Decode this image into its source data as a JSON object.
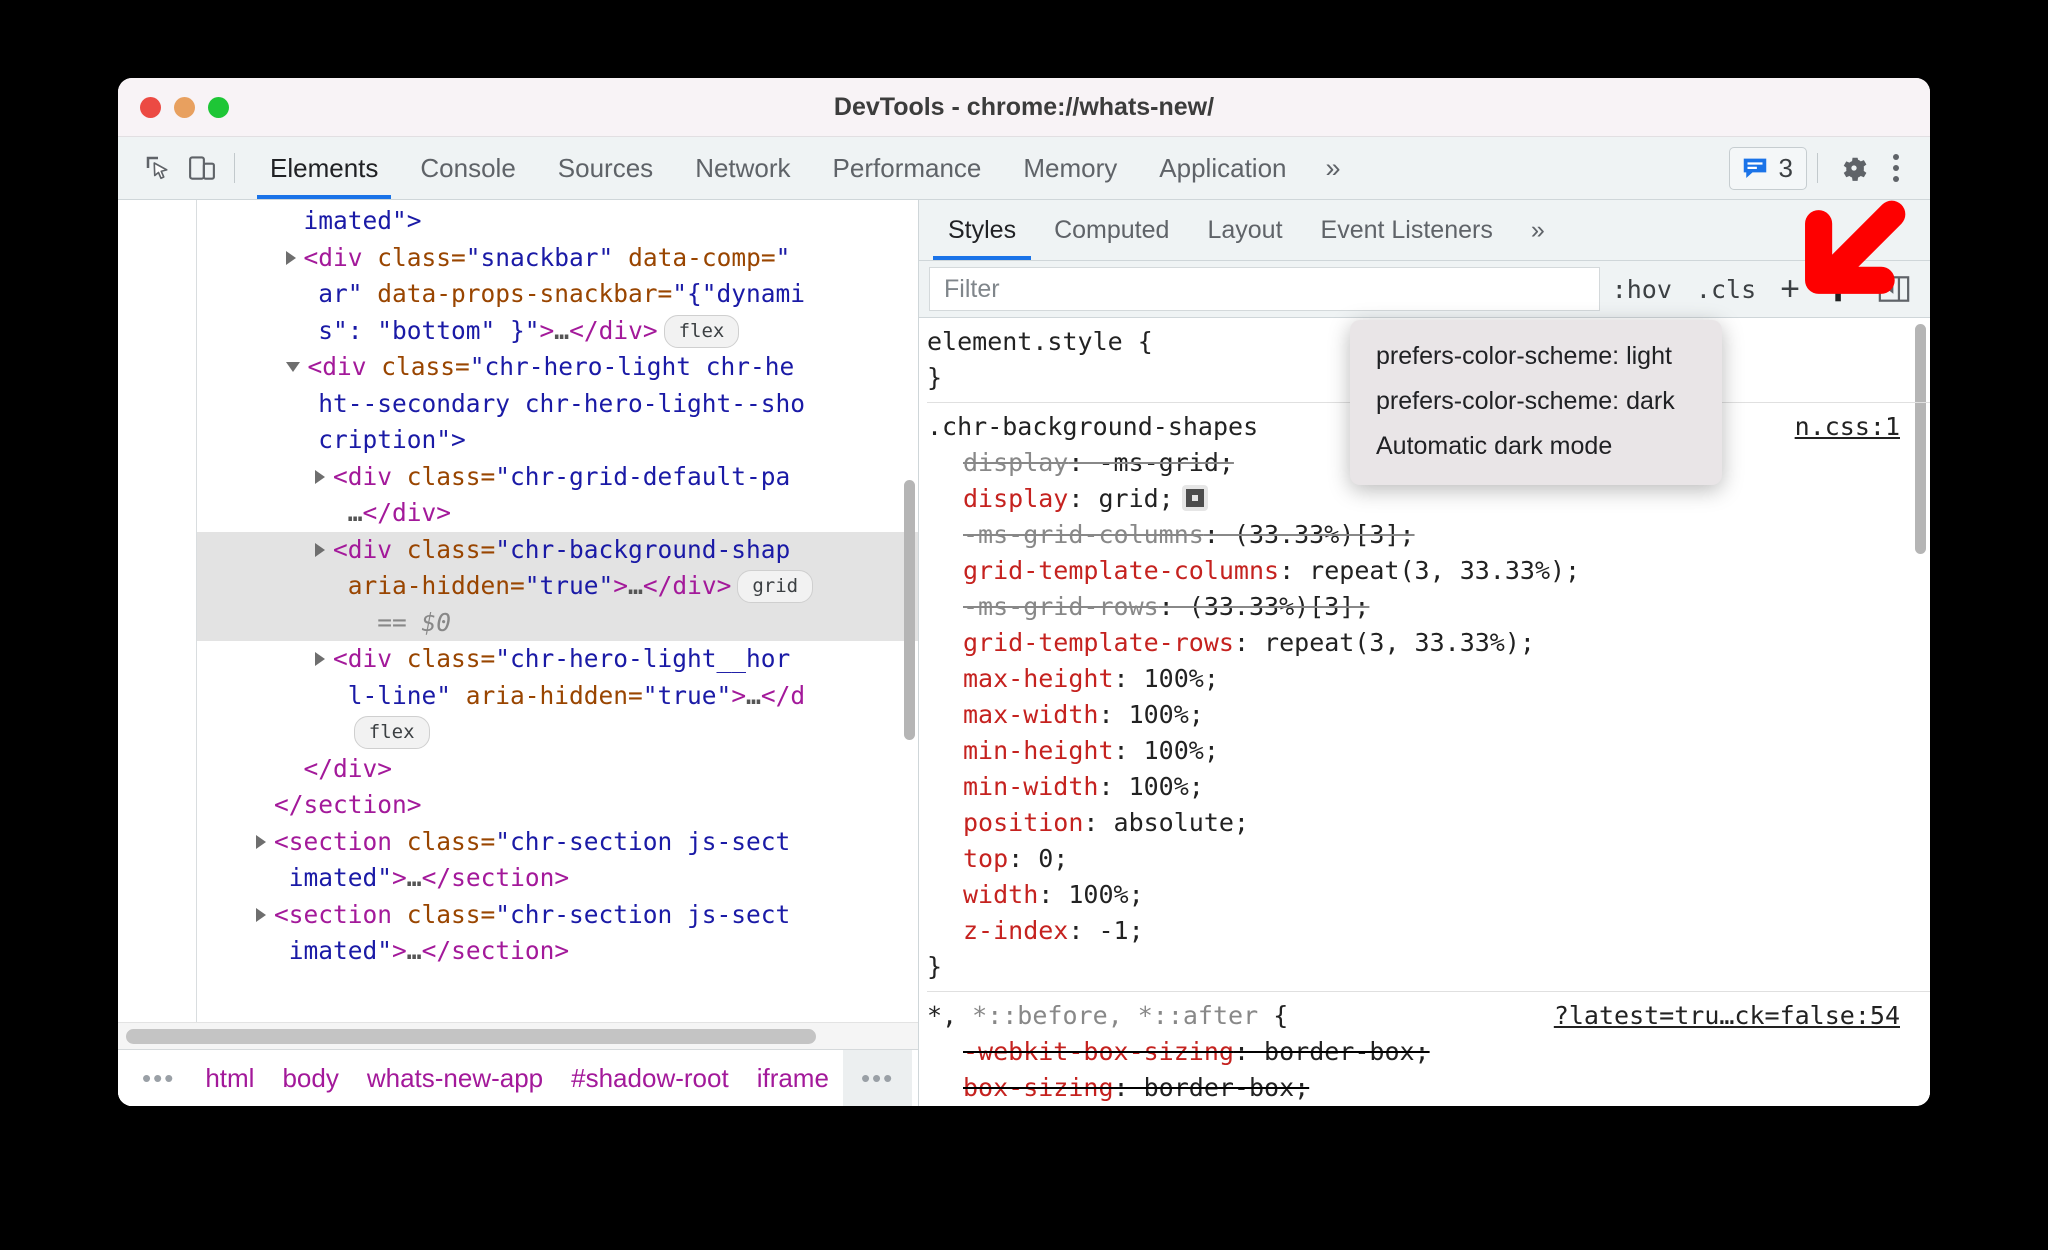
{
  "window": {
    "title": "DevTools - chrome://whats-new/",
    "traffic_lights": [
      "close",
      "minimize",
      "zoom"
    ]
  },
  "toolbar": {
    "inspect_icon": "inspect-cursor-icon",
    "device_icon": "device-toolbar-icon",
    "tabs": [
      {
        "label": "Elements",
        "active": true
      },
      {
        "label": "Console",
        "active": false
      },
      {
        "label": "Sources",
        "active": false
      },
      {
        "label": "Network",
        "active": false
      },
      {
        "label": "Performance",
        "active": false
      },
      {
        "label": "Memory",
        "active": false
      },
      {
        "label": "Application",
        "active": false
      }
    ],
    "more_tabs": "»",
    "issues_icon": "issues-message-icon",
    "issues_count": "3",
    "settings_icon": "gear-icon",
    "menu_icon": "kebab-menu-icon"
  },
  "dom_tree": {
    "rows": [
      {
        "id": "row-imated-open",
        "indent": 3,
        "selected": false,
        "lines": [
          {
            "segments": [
              {
                "t": "imated\">",
                "c": "val"
              }
            ]
          }
        ]
      },
      {
        "id": "row-snackbar",
        "indent": 3,
        "selected": false,
        "arrow": "closed",
        "lines": [
          {
            "segments": [
              {
                "t": "<div",
                "c": "tag"
              },
              {
                "t": " class=",
                "c": "attr"
              },
              {
                "t": "\"snackbar\"",
                "c": "val"
              },
              {
                "t": " data-comp=",
                "c": "attr"
              },
              {
                "t": "\"",
                "c": "val"
              }
            ]
          },
          {
            "segments": [
              {
                "t": "ar\"",
                "c": "val"
              },
              {
                "t": " data-props-snackbar=",
                "c": "attr"
              },
              {
                "t": "\"{\"dynami",
                "c": "val"
              }
            ]
          },
          {
            "segments": [
              {
                "t": "s\": \"bottom\" }\"",
                "c": "val"
              },
              {
                "t": ">",
                "c": "punct"
              },
              {
                "t": "…",
                "c": "ell"
              },
              {
                "t": "</div>",
                "c": "punct"
              }
            ],
            "badge": "flex"
          }
        ]
      },
      {
        "id": "row-chr-hero-light",
        "indent": 3,
        "selected": false,
        "arrow": "open",
        "lines": [
          {
            "segments": [
              {
                "t": "<div",
                "c": "tag"
              },
              {
                "t": " class=",
                "c": "attr"
              },
              {
                "t": "\"chr-hero-light chr-he",
                "c": "val"
              }
            ]
          },
          {
            "segments": [
              {
                "t": "ht--secondary chr-hero-light--sho",
                "c": "val"
              }
            ]
          },
          {
            "segments": [
              {
                "t": "cription\">",
                "c": "val"
              }
            ]
          }
        ]
      },
      {
        "id": "row-chr-grid-default",
        "indent": 4,
        "selected": false,
        "arrow": "closed",
        "lines": [
          {
            "segments": [
              {
                "t": "<div",
                "c": "tag"
              },
              {
                "t": " class=",
                "c": "attr"
              },
              {
                "t": "\"chr-grid-default-pa",
                "c": "val"
              }
            ]
          },
          {
            "segments": [
              {
                "t": "…",
                "c": "ell"
              },
              {
                "t": "</div>",
                "c": "punct"
              }
            ]
          }
        ]
      },
      {
        "id": "row-chr-background-shapes",
        "indent": 4,
        "selected": true,
        "arrow": "closed",
        "gutter_dots": "…",
        "lines": [
          {
            "segments": [
              {
                "t": "<div",
                "c": "tag"
              },
              {
                "t": " class=",
                "c": "attr"
              },
              {
                "t": "\"chr-background-shap",
                "c": "val"
              }
            ]
          },
          {
            "segments": [
              {
                "t": "aria-hidden=",
                "c": "attr"
              },
              {
                "t": "\"true\"",
                "c": "val"
              },
              {
                "t": ">",
                "c": "punct"
              },
              {
                "t": "…",
                "c": "ell"
              },
              {
                "t": "</div>",
                "c": "punct"
              }
            ],
            "badge": "grid"
          },
          {
            "segments": [
              {
                "t": "  == ",
                "c": "eq"
              },
              {
                "t": "$0",
                "c": "dollar"
              }
            ]
          }
        ]
      },
      {
        "id": "row-chr-hero-light-horizontal",
        "indent": 4,
        "selected": false,
        "arrow": "closed",
        "lines": [
          {
            "segments": [
              {
                "t": "<div",
                "c": "tag"
              },
              {
                "t": " class=",
                "c": "attr"
              },
              {
                "t": "\"chr-hero-light__hor",
                "c": "val"
              }
            ]
          },
          {
            "segments": [
              {
                "t": "l-line\"",
                "c": "val"
              },
              {
                "t": " aria-hidden=",
                "c": "attr"
              },
              {
                "t": "\"true\"",
                "c": "val"
              },
              {
                "t": ">",
                "c": "punct"
              },
              {
                "t": "…",
                "c": "ell"
              },
              {
                "t": "</d",
                "c": "punct"
              }
            ]
          },
          {
            "segments": [],
            "badge_only": "flex"
          }
        ]
      },
      {
        "id": "row-close-div",
        "indent": 3,
        "selected": false,
        "lines": [
          {
            "segments": [
              {
                "t": "</div>",
                "c": "punct"
              }
            ]
          }
        ]
      },
      {
        "id": "row-close-section",
        "indent": 2,
        "selected": false,
        "lines": [
          {
            "segments": [
              {
                "t": "</section>",
                "c": "punct"
              }
            ]
          }
        ]
      },
      {
        "id": "row-section-1",
        "indent": 2,
        "selected": false,
        "arrow": "closed",
        "lines": [
          {
            "segments": [
              {
                "t": "<section",
                "c": "tag"
              },
              {
                "t": " class=",
                "c": "attr"
              },
              {
                "t": "\"chr-section js-sect",
                "c": "val"
              }
            ]
          },
          {
            "segments": [
              {
                "t": "imated\"",
                "c": "val"
              },
              {
                "t": ">",
                "c": "punct"
              },
              {
                "t": "…",
                "c": "ell"
              },
              {
                "t": "</section>",
                "c": "punct"
              }
            ]
          }
        ]
      },
      {
        "id": "row-section-2",
        "indent": 2,
        "selected": false,
        "arrow": "closed",
        "lines": [
          {
            "segments": [
              {
                "t": "<section",
                "c": "tag"
              },
              {
                "t": " class=",
                "c": "attr"
              },
              {
                "t": "\"chr-section js-sect",
                "c": "val"
              }
            ]
          },
          {
            "segments": [
              {
                "t": "imated\"",
                "c": "val"
              },
              {
                "t": ">",
                "c": "punct"
              },
              {
                "t": "…",
                "c": "ell"
              },
              {
                "t": "</section>",
                "c": "punct"
              }
            ]
          }
        ]
      }
    ]
  },
  "breadcrumb": {
    "leading_dots": "…",
    "items": [
      "html",
      "body",
      "whats-new-app",
      "#shadow-root",
      "iframe"
    ],
    "trailing_dots": "…"
  },
  "styles_pane": {
    "tabs": [
      {
        "label": "Styles",
        "active": true
      },
      {
        "label": "Computed",
        "active": false
      },
      {
        "label": "Layout",
        "active": false
      },
      {
        "label": "Event Listeners",
        "active": false
      }
    ],
    "more_tabs": "»",
    "filter_placeholder": "Filter",
    "hov_label": ":hov",
    "cls_label": ".cls",
    "new_rule_label": "+",
    "render_emulation_icon": "paintbrush-icon",
    "toggle_sidebar_icon": "toggle-sidebar-icon"
  },
  "emulation_popup": {
    "items": [
      "prefers-color-scheme: light",
      "prefers-color-scheme: dark",
      "Automatic dark mode"
    ]
  },
  "css_rules": [
    {
      "selector": "element.style {",
      "close": "}",
      "source": "",
      "declarations": []
    },
    {
      "selector": ".chr-background-shapes",
      "selector_suffix": "",
      "source": "n.css:1",
      "close": "}",
      "declarations": [
        {
          "prop": "display",
          "value": "-ms-grid",
          "state": "strike-gray"
        },
        {
          "prop": "display",
          "value": "grid",
          "state": "active",
          "badge": "grid-icon"
        },
        {
          "prop": "-ms-grid-columns",
          "value": "(33.33%)[3]",
          "state": "strike-gray"
        },
        {
          "prop": "grid-template-columns",
          "value": "repeat(3, 33.33%)",
          "state": "active"
        },
        {
          "prop": "-ms-grid-rows",
          "value": "(33.33%)[3]",
          "state": "strike-gray"
        },
        {
          "prop": "grid-template-rows",
          "value": "repeat(3, 33.33%)",
          "state": "active"
        },
        {
          "prop": "max-height",
          "value": "100%",
          "state": "active"
        },
        {
          "prop": "max-width",
          "value": "100%",
          "state": "active"
        },
        {
          "prop": "min-height",
          "value": "100%",
          "state": "active"
        },
        {
          "prop": "min-width",
          "value": "100%",
          "state": "active"
        },
        {
          "prop": "position",
          "value": "absolute",
          "state": "active"
        },
        {
          "prop": "top",
          "value": "0",
          "state": "active"
        },
        {
          "prop": "width",
          "value": "100%",
          "state": "active"
        },
        {
          "prop": "z-index",
          "value": "-1",
          "state": "active"
        }
      ]
    },
    {
      "selector": "*, ",
      "selector_dim": "*::before, *::after",
      "selector_end": " {",
      "source": "?latest=tru…ck=false:54",
      "close": "",
      "declarations": [
        {
          "prop": "-webkit-box-sizing",
          "value": "border-box",
          "state": "strike-red"
        },
        {
          "prop": "box-sizing",
          "value": "border-box",
          "state": "strike-red"
        }
      ]
    }
  ],
  "annotation": {
    "arrow_color": "#fe0000",
    "arrow_direction": "down-left"
  }
}
